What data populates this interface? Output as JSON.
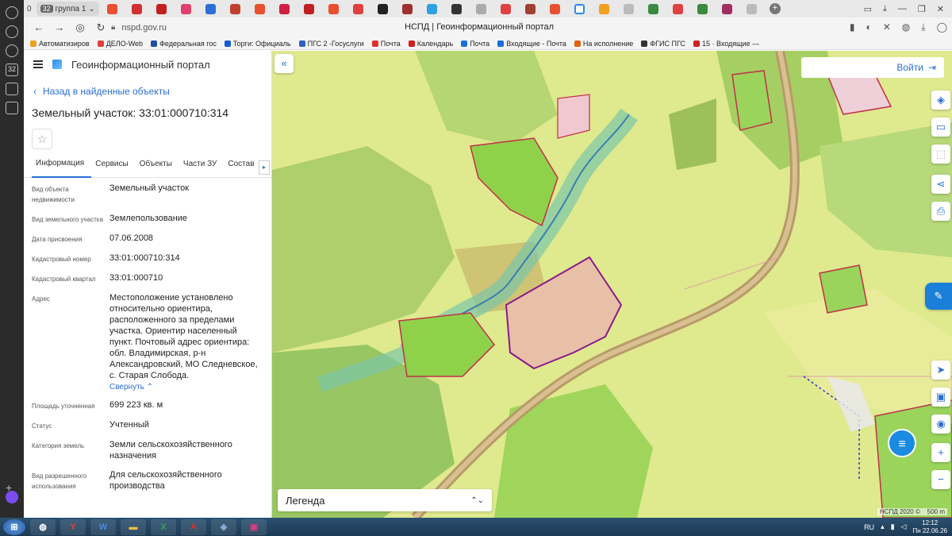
{
  "browser": {
    "tab_group_count": "32",
    "tab_group_name": "группа 1",
    "url": "nspd.gov.ru",
    "page_title": "НСПД | Геоинформационный портал",
    "rail_count": "32"
  },
  "bookmarks": [
    {
      "label": "Автоматизиров",
      "color": "#f0a020"
    },
    {
      "label": "ДЕЛО-Web",
      "color": "#e04040"
    },
    {
      "label": "Федеральная гос",
      "color": "#2050a0"
    },
    {
      "label": "Торги: Официаль",
      "color": "#1060d0"
    },
    {
      "label": "ПГС 2 -Госуслуги",
      "color": "#3060c0"
    },
    {
      "label": "Почта",
      "color": "#e03030"
    },
    {
      "label": "Календарь",
      "color": "#d02020"
    },
    {
      "label": "Почта",
      "color": "#1a6fd8"
    },
    {
      "label": "Входящие - Почта",
      "color": "#1a6fd8"
    },
    {
      "label": "На исполнение",
      "color": "#e06010"
    },
    {
      "label": "ФГИС ПГС",
      "color": "#333333"
    },
    {
      "label": "15 · Входящие —",
      "color": "#d02020"
    }
  ],
  "panel": {
    "portal_name": "Геоинформационный портал",
    "back_link": "Назад в найденные объекты",
    "object_title": "Земельный участок: 33:01:000710:314",
    "tabs": [
      "Информация",
      "Сервисы",
      "Объекты",
      "Части ЗУ",
      "Состав"
    ],
    "collapse_label": "Свернуть",
    "properties": [
      {
        "key": "Вид объекта недвижимости",
        "value": "Земельный участок"
      },
      {
        "key": "Вид земельного участка",
        "value": "Землепользование"
      },
      {
        "key": "Дата присвоения",
        "value": "07.06.2008"
      },
      {
        "key": "Кадастровый номер",
        "value": "33:01:000710:314"
      },
      {
        "key": "Кадастровый квартал",
        "value": "33:01:000710"
      },
      {
        "key": "Адрес",
        "value": "Местоположение установлено относительно ориентира, расположенного за пределами участка. Ориентир населенный пункт. Почтовый адрес ориентира: обл. Владимирская, р-н Александровский, МО Следневское, с. Старая Слобода."
      },
      {
        "key": "Площадь уточненная",
        "value": "699 223 кв. м"
      },
      {
        "key": "Статус",
        "value": "Учтенный"
      },
      {
        "key": "Категория земель",
        "value": "Земли сельскохозяйственного назначения"
      },
      {
        "key": "Вид разрешенного использования",
        "value": "Для сельскохозяйственного производства"
      }
    ]
  },
  "map": {
    "login_label": "Войти",
    "legend_label": "Легенда",
    "copyright": "НСПД 2020 ©",
    "scale": "500 m"
  },
  "taskbar": {
    "lang": "RU",
    "time": "12:12",
    "date": "Пн 22.06.26"
  }
}
